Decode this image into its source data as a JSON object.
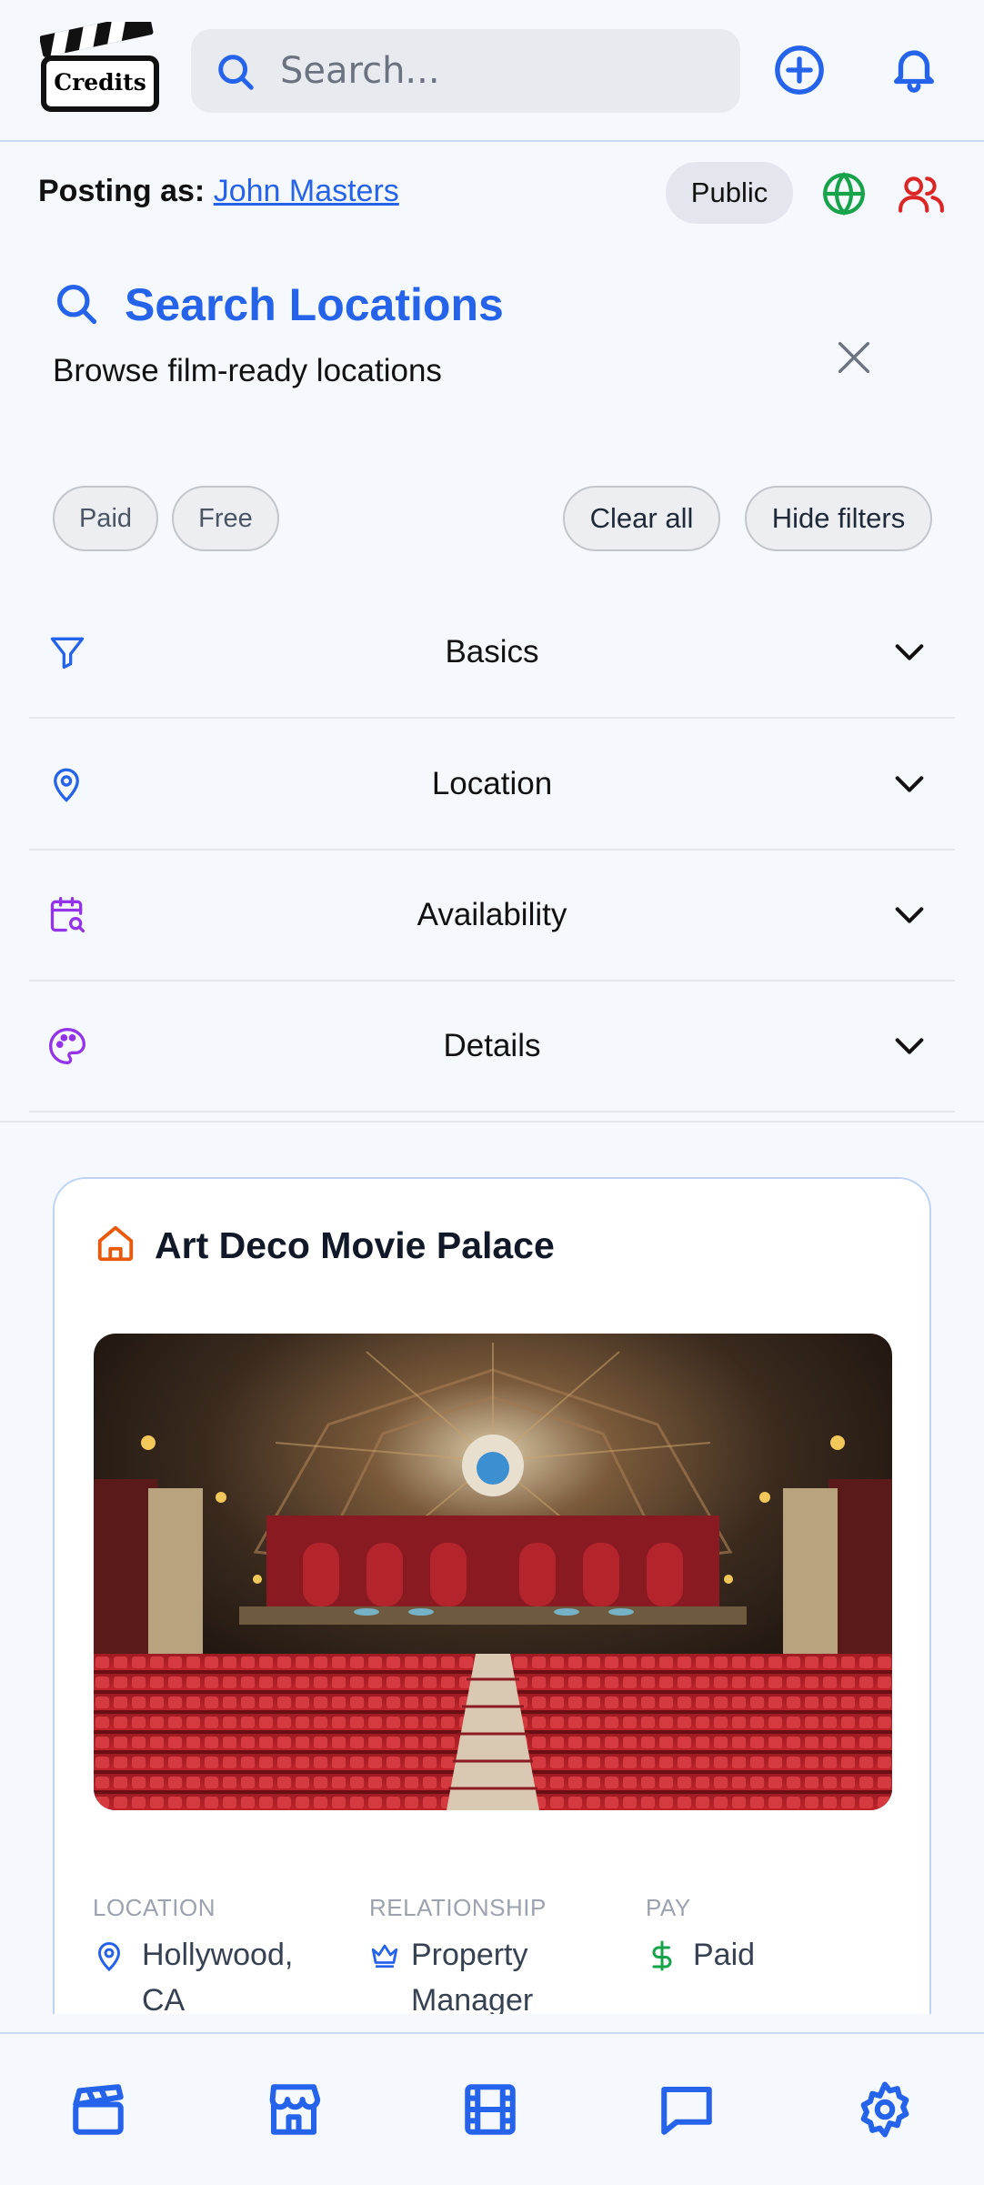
{
  "header": {
    "logo_text": "Credits",
    "search_placeholder": "Search...",
    "icons": [
      "plus-circle-icon",
      "bell-icon"
    ]
  },
  "posting": {
    "prefix": "Posting as:",
    "user": "John Masters",
    "visibility": "Public"
  },
  "search_section": {
    "title": "Search Locations",
    "subtitle": "Browse film-ready locations"
  },
  "filters": {
    "chips": [
      "Paid",
      "Free"
    ],
    "clear_all": "Clear all",
    "hide_filters": "Hide filters"
  },
  "accordion": [
    {
      "label": "Basics",
      "icon": "filter-icon",
      "color": "#2563eb"
    },
    {
      "label": "Location",
      "icon": "map-pin-icon",
      "color": "#2563eb"
    },
    {
      "label": "Availability",
      "icon": "calendar-search-icon",
      "color": "#9333ea"
    },
    {
      "label": "Details",
      "icon": "palette-icon",
      "color": "#9333ea"
    }
  ],
  "card": {
    "title": "Art Deco Movie Palace",
    "meta": [
      {
        "heading": "LOCATION",
        "value": "Hollywood, CA",
        "icon": "map-pin-icon"
      },
      {
        "heading": "RELATIONSHIP",
        "value": "Property Manager",
        "icon": "crown-icon"
      },
      {
        "heading": "PAY",
        "value": "Paid",
        "icon": "dollar-icon"
      }
    ]
  },
  "bottom_nav": [
    "clapperboard-icon",
    "store-icon",
    "film-icon",
    "message-icon",
    "settings-icon"
  ],
  "colors": {
    "accent": "#2563eb",
    "purple": "#9333ea",
    "green": "#16a34a",
    "red": "#dc2626",
    "orange": "#ea580c"
  }
}
